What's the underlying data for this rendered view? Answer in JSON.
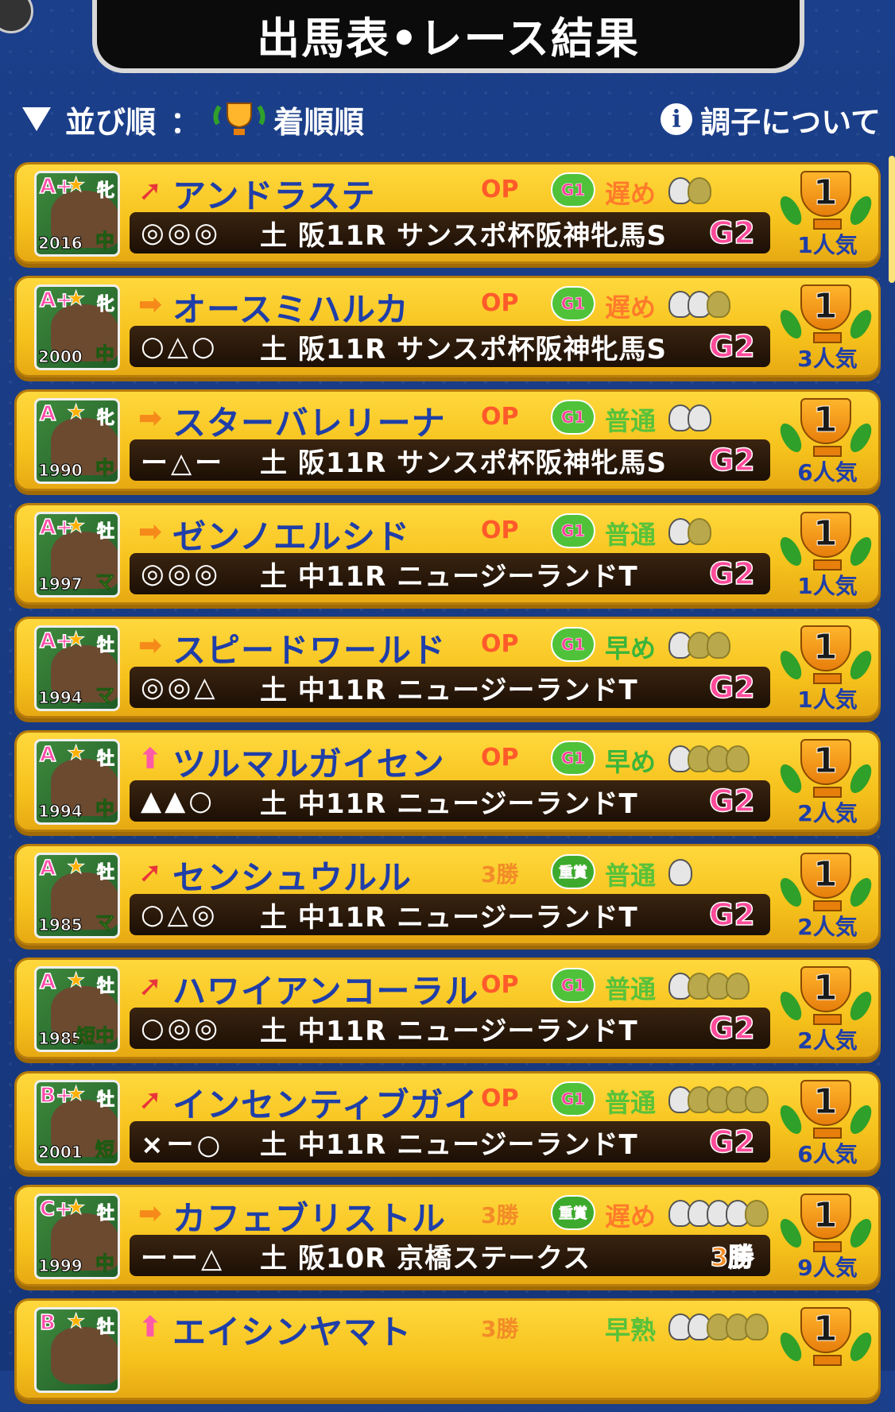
{
  "header": {
    "title": "出馬表•レース結果"
  },
  "sort": {
    "label": "並び順",
    "separator": "：",
    "value": "着順順",
    "info_label": "調子について",
    "info_icon": "i"
  },
  "entries": [
    {
      "rank": "A+",
      "sex": "牝",
      "sex_type": "f",
      "year": "2016",
      "dist": "中",
      "arrow": "diag",
      "name": "アンドラステ",
      "cls": "OP",
      "badge": "G1",
      "style": "遅め",
      "style_type": "late",
      "shoes_on": 1,
      "shoes_total": 2,
      "marks": "◎◎◎",
      "race": "土 阪11R サンスポ杯阪神牝馬S",
      "grade": "G2",
      "place": "1",
      "pop": "1人気"
    },
    {
      "rank": "A+",
      "sex": "牝",
      "sex_type": "f",
      "year": "2000",
      "dist": "中",
      "arrow": "right",
      "name": "オースミハルカ",
      "cls": "OP",
      "badge": "G1",
      "style": "遅め",
      "style_type": "late",
      "shoes_on": 2,
      "shoes_total": 3,
      "marks": "○△○",
      "race": "土 阪11R サンスポ杯阪神牝馬S",
      "grade": "G2",
      "place": "1",
      "pop": "3人気"
    },
    {
      "rank": "A",
      "sex": "牝",
      "sex_type": "f",
      "year": "1990",
      "dist": "中",
      "arrow": "right",
      "name": "スターバレリーナ",
      "cls": "OP",
      "badge": "G1",
      "style": "普通",
      "style_type": "normal",
      "shoes_on": 2,
      "shoes_total": 2,
      "marks": "ー△ー",
      "race": "土 阪11R サンスポ杯阪神牝馬S",
      "grade": "G2",
      "place": "1",
      "pop": "6人気"
    },
    {
      "rank": "A+",
      "sex": "牡",
      "sex_type": "m",
      "year": "1997",
      "dist": "マ",
      "arrow": "right",
      "name": "ゼンノエルシド",
      "cls": "OP",
      "badge": "G1",
      "style": "普通",
      "style_type": "normal",
      "shoes_on": 1,
      "shoes_total": 2,
      "marks": "◎◎◎",
      "race": "土 中11R ニュージーランドT",
      "grade": "G2",
      "place": "1",
      "pop": "1人気"
    },
    {
      "rank": "A+",
      "sex": "牡",
      "sex_type": "m",
      "year": "1994",
      "dist": "マ",
      "arrow": "right",
      "name": "スピードワールド",
      "cls": "OP",
      "badge": "G1",
      "style": "早め",
      "style_type": "early",
      "shoes_on": 1,
      "shoes_total": 3,
      "marks": "◎◎△",
      "race": "土 中11R ニュージーランドT",
      "grade": "G2",
      "place": "1",
      "pop": "1人気"
    },
    {
      "rank": "A",
      "sex": "牡",
      "sex_type": "m",
      "year": "1994",
      "dist": "中",
      "arrow": "up",
      "name": "ツルマルガイセン",
      "cls": "OP",
      "badge": "G1",
      "style": "早め",
      "style_type": "early",
      "shoes_on": 1,
      "shoes_total": 4,
      "marks": "▲▲○",
      "race": "土 中11R ニュージーランドT",
      "grade": "G2",
      "place": "1",
      "pop": "2人気"
    },
    {
      "rank": "A",
      "sex": "牡",
      "sex_type": "m",
      "year": "1985",
      "dist": "マ",
      "arrow": "diag",
      "name": "センシュウルル",
      "cls": "3勝",
      "badge": "重賞",
      "style": "普通",
      "style_type": "normal",
      "shoes_on": 1,
      "shoes_total": 1,
      "marks": "○△◎",
      "race": "土 中11R ニュージーランドT",
      "grade": "G2",
      "place": "1",
      "pop": "2人気"
    },
    {
      "rank": "A",
      "sex": "牡",
      "sex_type": "m",
      "year": "1985",
      "dist": "短中",
      "arrow": "diag",
      "name": "ハワイアンコーラル",
      "cls": "OP",
      "badge": "G1",
      "style": "普通",
      "style_type": "normal",
      "shoes_on": 1,
      "shoes_total": 4,
      "marks": "○◎◎",
      "race": "土 中11R ニュージーランドT",
      "grade": "G2",
      "place": "1",
      "pop": "2人気"
    },
    {
      "rank": "B+",
      "sex": "牡",
      "sex_type": "m",
      "year": "2001",
      "dist": "短",
      "arrow": "diag",
      "name": "インセンティブガイ",
      "cls": "OP",
      "badge": "G1",
      "style": "普通",
      "style_type": "normal",
      "shoes_on": 1,
      "shoes_total": 5,
      "marks": "×ー○",
      "race": "土 中11R ニュージーランドT",
      "grade": "G2",
      "place": "1",
      "pop": "6人気"
    },
    {
      "rank": "C+",
      "sex": "牡",
      "sex_type": "m",
      "year": "1999",
      "dist": "中",
      "arrow": "right",
      "name": "カフェブリストル",
      "cls": "3勝",
      "badge": "重賞",
      "style": "遅め",
      "style_type": "late",
      "shoes_on": 4,
      "shoes_total": 5,
      "marks": "ーー△",
      "race": "土 阪10R 京橋ステークス",
      "grade": "3勝",
      "place": "1",
      "pop": "9人気"
    },
    {
      "rank": "B",
      "sex": "牡",
      "sex_type": "m",
      "year": "",
      "dist": "",
      "arrow": "up",
      "name": "エイシンヤマト",
      "cls": "3勝",
      "badge": "",
      "style": "早熟",
      "style_type": "normal",
      "shoes_on": 2,
      "shoes_total": 5,
      "marks": "",
      "race": "",
      "grade": "",
      "place": "1",
      "pop": ""
    }
  ]
}
